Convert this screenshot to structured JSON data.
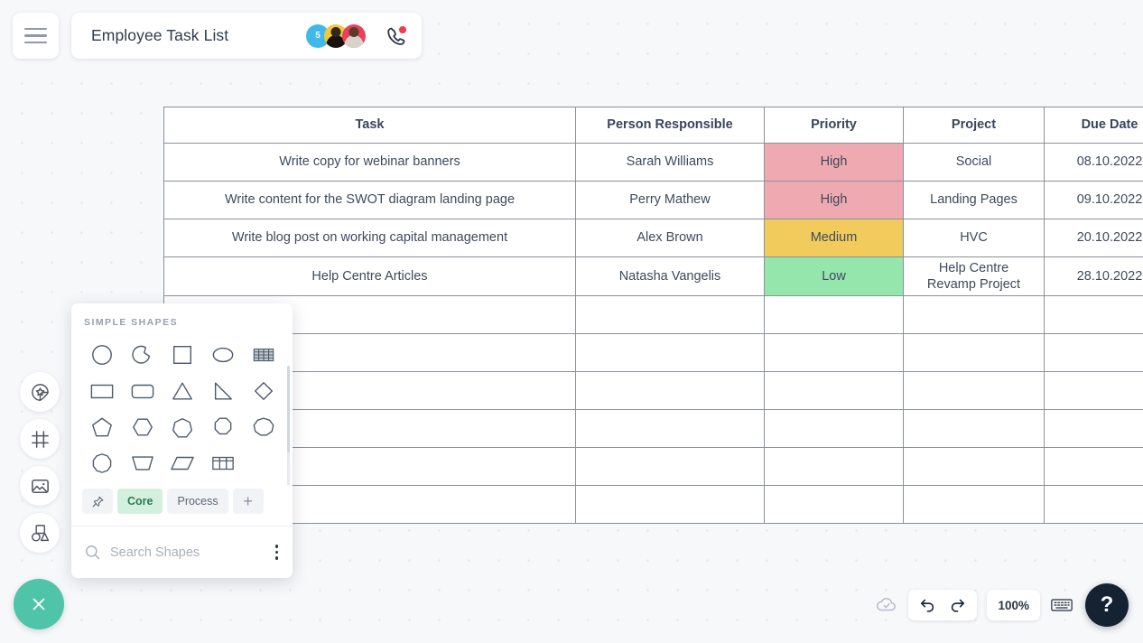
{
  "app": {
    "menu_icon": "hamburger-menu-icon",
    "document_title": "Employee Task List"
  },
  "collaborators": [
    {
      "type": "count-badge",
      "label": "5",
      "color": "#3fb8ea"
    },
    {
      "type": "photo",
      "label": "",
      "color": "#f4c63c"
    },
    {
      "type": "photo",
      "label": "",
      "color": "#e8425a"
    }
  ],
  "call_button": {
    "icon": "phone-icon",
    "has_notification": true,
    "notification_color": "#ef3d4e"
  },
  "table": {
    "columns": [
      "Task",
      "Person Responsible",
      "Priority",
      "Project",
      "Due Date"
    ],
    "rows": [
      {
        "task": "Write copy for webinar banners",
        "person": "Sarah Williams",
        "priority": "High",
        "priority_color": "#efa9b1",
        "project": "Social",
        "due_date": "08.10.2022"
      },
      {
        "task": "Write content for the SWOT diagram landing page",
        "person": "Perry Mathew",
        "priority": "High",
        "priority_color": "#efa9b1",
        "project": "Landing Pages",
        "due_date": "09.10.2022"
      },
      {
        "task": "Write blog post on working capital management",
        "person": "Alex Brown",
        "priority": "Medium",
        "priority_color": "#f1cb5b",
        "project": "HVC",
        "due_date": "20.10.2022"
      },
      {
        "task": "Help Centre Articles",
        "person": "Natasha Vangelis",
        "priority": "Low",
        "priority_color": "#95e6ad",
        "project": "Help Centre\nRevamp Project",
        "due_date": "28.10.2022"
      }
    ],
    "empty_row_count": 6
  },
  "tool_rail": [
    {
      "icon": "sticker-star-icon",
      "name": "sticker-tool"
    },
    {
      "icon": "frame-icon",
      "name": "frame-tool"
    },
    {
      "icon": "image-icon",
      "name": "image-tool"
    },
    {
      "icon": "shapes-icon",
      "name": "shapes-tool"
    }
  ],
  "shapes_panel": {
    "heading": "SIMPLE SHAPES",
    "shapes": [
      {
        "name": "circle-shape"
      },
      {
        "name": "arc-shape"
      },
      {
        "name": "square-shape"
      },
      {
        "name": "ellipse-shape"
      },
      {
        "name": "striped-table-shape"
      },
      {
        "name": "rectangle-shape"
      },
      {
        "name": "rounded-rectangle-shape"
      },
      {
        "name": "triangle-shape"
      },
      {
        "name": "right-triangle-shape"
      },
      {
        "name": "diamond-shape"
      },
      {
        "name": "pentagon-shape"
      },
      {
        "name": "hexagon-shape"
      },
      {
        "name": "heptagon-shape"
      },
      {
        "name": "octagon-shape"
      },
      {
        "name": "nonagon-shape"
      },
      {
        "name": "decagon-shape"
      },
      {
        "name": "trapezoid-shape"
      },
      {
        "name": "parallelogram-shape"
      },
      {
        "name": "grid-table-shape"
      }
    ],
    "tabs": [
      {
        "label": "",
        "icon": "pin-icon",
        "active": false,
        "kind": "pin"
      },
      {
        "label": "Core",
        "active": true,
        "kind": "text"
      },
      {
        "label": "Process",
        "active": false,
        "kind": "text"
      },
      {
        "label": "+",
        "active": false,
        "kind": "plus"
      }
    ],
    "search_placeholder": "Search Shapes",
    "overflow_menu": "three-dots-icon"
  },
  "close_button": {
    "icon": "close-icon",
    "color": "#4fc4a8"
  },
  "bottom_toolbar": {
    "save_status_icon": "cloud-check-icon",
    "undo_icon": "undo-icon",
    "redo_icon": "redo-icon",
    "zoom_level": "100%",
    "keyboard_icon": "keyboard-icon",
    "help_label": "?"
  }
}
